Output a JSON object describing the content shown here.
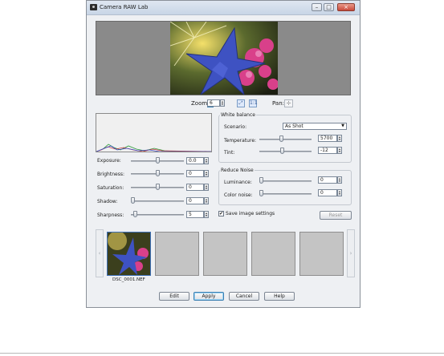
{
  "window": {
    "title": "Camera RAW Lab"
  },
  "title_buttons": {
    "minimize": "–",
    "maximize": "□",
    "close": "×"
  },
  "zoom": {
    "label": "Zoom",
    "value": "6",
    "pan_label": "Pan:"
  },
  "adjustments": [
    {
      "label": "Exposure:",
      "value": "0.0",
      "level": 0.5
    },
    {
      "label": "Brightness:",
      "value": "0",
      "level": 0.5
    },
    {
      "label": "Saturation:",
      "value": "0",
      "level": 0.5
    },
    {
      "label": "Shadow:",
      "value": "0",
      "level": 0.0
    },
    {
      "label": "Sharpness:",
      "value": "5",
      "level": 0.05
    }
  ],
  "white_balance": {
    "title": "White balance",
    "scenario_label": "Scenario:",
    "scenario_value": "As Shot",
    "temperature_label": "Temperature:",
    "temperature_value": "5700",
    "temperature_level": 0.42,
    "tint_label": "Tint:",
    "tint_value": "-12",
    "tint_level": 0.44
  },
  "reduce_noise": {
    "title": "Reduce Noise",
    "luminance_label": "Luminance:",
    "luminance_value": "0",
    "color_noise_label": "Color noise:",
    "color_noise_value": "0"
  },
  "save_settings": {
    "label": "Save image settings",
    "checked": true
  },
  "reset_button": "Reset",
  "filmstrip": {
    "caption": "DSC_0001.NEF",
    "left_arrow": "‹",
    "right_arrow": "›"
  },
  "buttons": {
    "edit": "Edit",
    "apply": "Apply",
    "cancel": "Cancel",
    "help": "Help"
  },
  "colors": {
    "accent": "#3c7fb1",
    "preview_bg": "#8a8a8a",
    "thumb_bg": "#c4c4c4"
  }
}
